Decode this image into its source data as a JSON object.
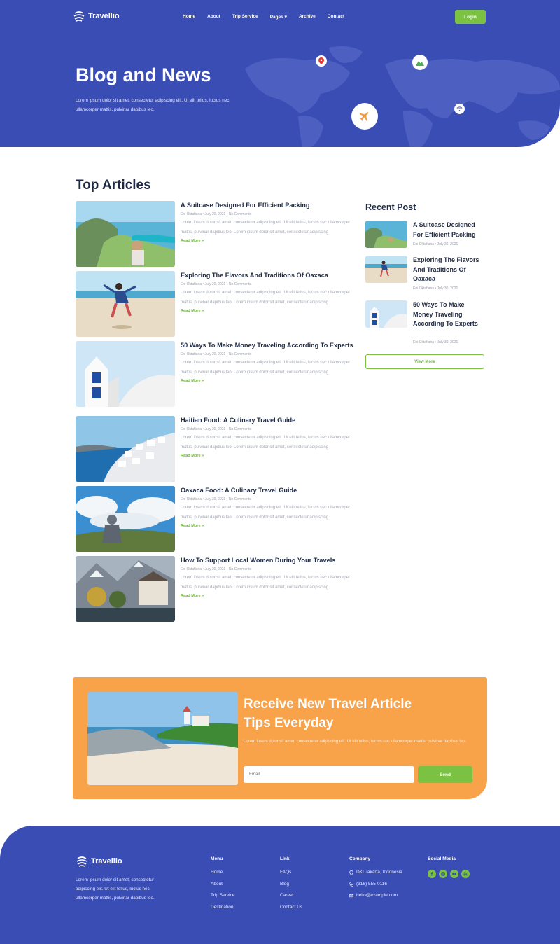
{
  "brand": {
    "name": "Travellio"
  },
  "nav": {
    "items": [
      "Home",
      "About",
      "Trip Service",
      "Pages",
      "Archive",
      "Contact"
    ],
    "login_label": "Login"
  },
  "hero": {
    "title": "Blog and News",
    "description": "Lorem ipsum dolor sit amet, consectetur adipiscing elit. Ut elit tellus, luctus nec ullamcorper mattis, pulvinar dapibus leo."
  },
  "articles_section": {
    "title": "Top Articles",
    "read_more": "Read More »",
    "excerpt": "Lorem ipsum dolor sit amet, consectetur adipiscing elit. Ut elit tellus, luctus nec ullamcorper mattis, pulvinar dapibus leo. Lorem ipsum dolor sit amet, consectetur adipiscing",
    "items": [
      {
        "title": "A Suitcase Designed For Efficient Packing",
        "meta": "Eni Oktafiana • July 30, 2021 • No Comments"
      },
      {
        "title": "Exploring The Flavors And Traditions Of Oaxaca",
        "meta": "Eni Oktafiana • July 30, 2021 • No Comments"
      },
      {
        "title": "50 Ways To Make Money Traveling According To Experts",
        "meta": "Eni Oktafiana • July 30, 2021 • No Comments"
      },
      {
        "title": "Haitian Food: A Culinary Travel Guide",
        "meta": "Eni Oktafiana • July 30, 2021 • No Comments"
      },
      {
        "title": "Oaxaca Food: A Culinary Travel Guide",
        "meta": "Eni Oktafiana • July 30, 2021 • No Comments"
      },
      {
        "title": "How To Support Local Women During Your Travels",
        "meta": "Eni Oktafiana • July 30, 2021 • No Comments"
      }
    ]
  },
  "recent": {
    "title": "Recent Post",
    "view_more": "View More",
    "items": [
      {
        "title": "A Suitcase Designed For Efficient Packing",
        "meta": "Eni Oktafiana • July 30, 2021"
      },
      {
        "title": "Exploring The Flavors And Traditions Of Oaxaca",
        "meta": "Eni Oktafiana • July 30, 2021"
      },
      {
        "title": "50 Ways To Make Money Traveling According To Experts",
        "meta": "Eni Oktafiana • July 30, 2021"
      }
    ]
  },
  "newsletter": {
    "title": "Receive New Travel Article Tips Everyday",
    "text": "Lorem ipsum dolor sit amet, consectetur adipiscing elit. Ut elit tellus, luctus nec ullamcorper mattis, pulvinar dapibus leo.",
    "placeholder": "Email",
    "send_label": "Send"
  },
  "footer": {
    "description": "Lorem ipsum dolor sit amet, consectetur adipiscing elit. Ut elit tellus, luctus nec ullamcorper mattis, pulvinar dapibus leo.",
    "menu": {
      "title": "Menu",
      "items": [
        "Home",
        "About",
        "Trip Service",
        "Destination"
      ]
    },
    "link": {
      "title": "Link",
      "items": [
        "FAQs",
        "Blog",
        "Career",
        "Contact Us"
      ]
    },
    "company": {
      "title": "Company",
      "address": "DKI Jakarta, Indonesia",
      "phone": "(316) 555-0116",
      "email": "hello@example.com"
    },
    "social": {
      "title": "Social Media",
      "icons": [
        "facebook-icon",
        "instagram-icon",
        "youtube-icon",
        "linkedin-icon"
      ]
    }
  },
  "colors": {
    "primary": "#3a4db5",
    "accent": "#7cc242",
    "orange": "#f8a24a"
  }
}
